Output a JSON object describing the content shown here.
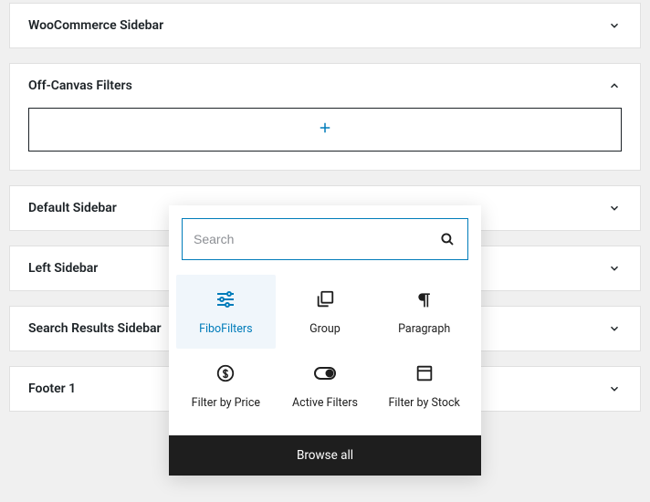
{
  "panels": [
    {
      "title": "WooCommerce Sidebar",
      "expanded": false
    },
    {
      "title": "Off-Canvas Filters",
      "expanded": true
    },
    {
      "title": "Default Sidebar",
      "expanded": false
    },
    {
      "title": "Left Sidebar",
      "expanded": false
    },
    {
      "title": "Search Results Sidebar",
      "expanded": false
    },
    {
      "title": "Footer 1",
      "expanded": false
    }
  ],
  "search": {
    "placeholder": "Search"
  },
  "blocks": [
    {
      "label": "FiboFilters",
      "icon": "filters-icon",
      "selected": true
    },
    {
      "label": "Group",
      "icon": "group-icon",
      "selected": false
    },
    {
      "label": "Paragraph",
      "icon": "paragraph-icon",
      "selected": false
    },
    {
      "label": "Filter by Price",
      "icon": "currency-icon",
      "selected": false
    },
    {
      "label": "Active Filters",
      "icon": "toggle-icon",
      "selected": false
    },
    {
      "label": "Filter by Stock",
      "icon": "box-icon",
      "selected": false
    }
  ],
  "browse_all": "Browse all"
}
